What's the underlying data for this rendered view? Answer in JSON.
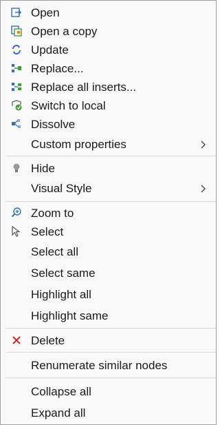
{
  "menu": {
    "items": {
      "open": {
        "label": "Open",
        "icon": "open-icon"
      },
      "open_copy": {
        "label": "Open a copy",
        "icon": "open-copy-icon"
      },
      "update": {
        "label": "Update",
        "icon": "update-icon"
      },
      "replace": {
        "label": "Replace...",
        "icon": "replace-icon"
      },
      "replace_all": {
        "label": "Replace all inserts...",
        "icon": "replace-all-icon"
      },
      "switch_local": {
        "label": "Switch to local",
        "icon": "switch-local-icon"
      },
      "dissolve": {
        "label": "Dissolve",
        "icon": "dissolve-icon"
      },
      "custom_props": {
        "label": "Custom properties",
        "icon": "chevron-right-icon"
      },
      "hide": {
        "label": "Hide",
        "icon": "lightbulb-icon"
      },
      "visual_style": {
        "label": "Visual Style",
        "icon": "chevron-right-icon"
      },
      "zoom_to": {
        "label": "Zoom to",
        "icon": "zoom-icon"
      },
      "select": {
        "label": "Select",
        "icon": "cursor-arrow-icon"
      },
      "select_all": {
        "label": "Select all"
      },
      "select_same": {
        "label": "Select same"
      },
      "highlight_all": {
        "label": "Highlight all"
      },
      "highlight_same": {
        "label": "Highlight same"
      },
      "delete": {
        "label": "Delete",
        "icon": "delete-x-icon"
      },
      "renumerate": {
        "label": "Renumerate similar nodes"
      },
      "collapse_all": {
        "label": "Collapse all"
      },
      "expand_all": {
        "label": "Expand all"
      }
    },
    "colors": {
      "icon_blue": "#3a6fb7",
      "icon_green": "#4a9b3a",
      "icon_orange": "#e08a1e",
      "delete_red": "#c42b1c",
      "separator": "#d9d9d9"
    }
  }
}
